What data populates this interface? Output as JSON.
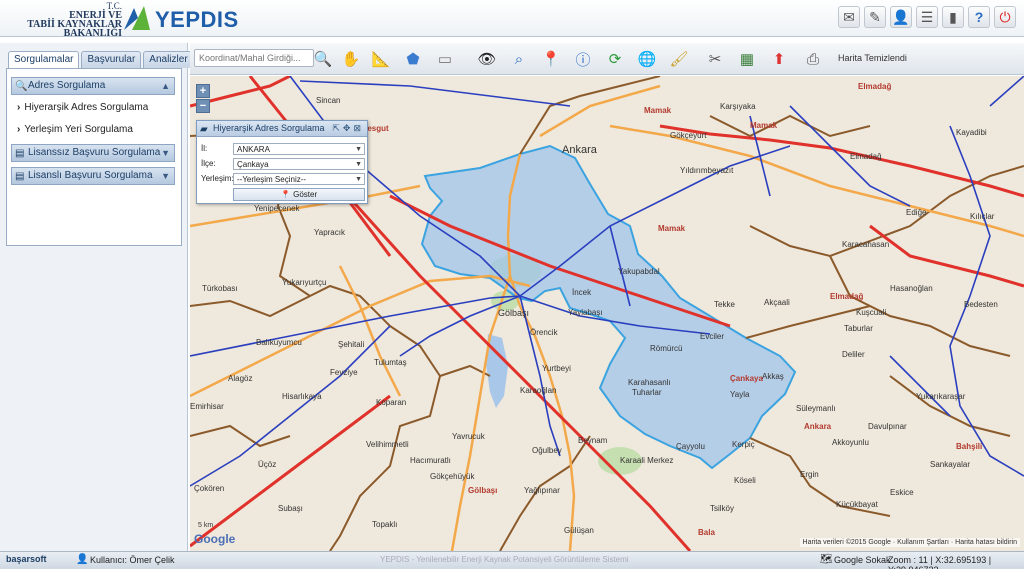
{
  "header": {
    "ministry_line1": "T.C.",
    "ministry_line2": "ENERJİ VE",
    "ministry_line3": "TABİİ KAYNAKLAR",
    "ministry_line4": "BAKANLIĞI",
    "app_name": "YEPDIS",
    "icons": [
      "mail-icon",
      "edit-icon",
      "user-icon",
      "list-icon",
      "document-icon",
      "help-icon",
      "logout-icon"
    ]
  },
  "left_panel": {
    "tabs": [
      "Sorgulamalar",
      "Başvurular",
      "Analizler"
    ],
    "sections": [
      {
        "label": "Adres Sorgulama",
        "items": [
          "Hiyerarşik Adres Sorgulama",
          "Yerleşim Yeri Sorgulama"
        ]
      },
      {
        "label": "Lisanssız Başvuru Sorgulama"
      },
      {
        "label": "Lisanslı Başvuru Sorgulama"
      }
    ]
  },
  "toolbar": {
    "search_placeholder": "Koordinat/Mahal Girdiği...",
    "layer_status": "Harita Temizlendi"
  },
  "dialog": {
    "title": "Hiyerarşik Adres Sorgulama",
    "il_label": "İl:",
    "il_value": "ANKARA",
    "ilce_label": "İlçe:",
    "ilce_value": "Çankaya",
    "yerlesim_label": "Yerleşim:",
    "yerlesim_value": "--Yerleşim Seçiniz--",
    "show_button": "Göster"
  },
  "map": {
    "zoom_in": "+",
    "zoom_out": "−",
    "scale": "5 km",
    "google": "Google",
    "attribution": "Harita verileri ©2015 Google · Kullanım Şartları · Harita hatası bildirin",
    "places": [
      {
        "name": "Sincan",
        "cls": ""
      },
      {
        "name": "Etimesgut",
        "cls": "red"
      },
      {
        "name": "Elmadağ",
        "cls": "red"
      },
      {
        "name": "Karşıyaka",
        "cls": ""
      },
      {
        "name": "Mamak",
        "cls": "red"
      },
      {
        "name": "Mamak",
        "cls": "red"
      },
      {
        "name": "Gökçeyurt",
        "cls": ""
      },
      {
        "name": "Kayadibi",
        "cls": ""
      },
      {
        "name": "Elmadağ",
        "cls": ""
      },
      {
        "name": "Ankara",
        "cls": ""
      },
      {
        "name": "Yıldırımbeyazıt",
        "cls": ""
      },
      {
        "name": "Mamak",
        "cls": "red"
      },
      {
        "name": "Ediğe",
        "cls": ""
      },
      {
        "name": "Kılıçlar",
        "cls": ""
      },
      {
        "name": "Yenipeçenek",
        "cls": ""
      },
      {
        "name": "Yapracık",
        "cls": ""
      },
      {
        "name": "Karacahasan",
        "cls": ""
      },
      {
        "name": "Yukarıyurtçu",
        "cls": ""
      },
      {
        "name": "Yakupabdal",
        "cls": ""
      },
      {
        "name": "Türkobası",
        "cls": ""
      },
      {
        "name": "Tekke",
        "cls": ""
      },
      {
        "name": "Akçaali",
        "cls": ""
      },
      {
        "name": "Hasanoğlan",
        "cls": ""
      },
      {
        "name": "Bedesten",
        "cls": ""
      },
      {
        "name": "Elmadağ",
        "cls": "red"
      },
      {
        "name": "İncek",
        "cls": ""
      },
      {
        "name": "Yaylabaşı",
        "cls": ""
      },
      {
        "name": "Gölbaşı",
        "cls": ""
      },
      {
        "name": "Örencik",
        "cls": ""
      },
      {
        "name": "Evciler",
        "cls": ""
      },
      {
        "name": "Taburlar",
        "cls": ""
      },
      {
        "name": "Kuşcuali",
        "cls": ""
      },
      {
        "name": "Balıkuyumcu",
        "cls": ""
      },
      {
        "name": "Şehitali",
        "cls": ""
      },
      {
        "name": "Tulumtaş",
        "cls": ""
      },
      {
        "name": "Römürcü",
        "cls": ""
      },
      {
        "name": "Deliler",
        "cls": ""
      },
      {
        "name": "Alagöz",
        "cls": ""
      },
      {
        "name": "Fevziye",
        "cls": ""
      },
      {
        "name": "Yurtbeyi",
        "cls": ""
      },
      {
        "name": "Çankaya",
        "cls": "red"
      },
      {
        "name": "Akkaş",
        "cls": ""
      },
      {
        "name": "Hisarlıkaya",
        "cls": ""
      },
      {
        "name": "Karaoğlan",
        "cls": ""
      },
      {
        "name": "Karahasanlı",
        "cls": ""
      },
      {
        "name": "Tuharlar",
        "cls": ""
      },
      {
        "name": "Yayla",
        "cls": ""
      },
      {
        "name": "Yukarıkaraşar",
        "cls": ""
      },
      {
        "name": "Emirhisar",
        "cls": ""
      },
      {
        "name": "Koparan",
        "cls": ""
      },
      {
        "name": "Süleymanlı",
        "cls": ""
      },
      {
        "name": "Davulpınar",
        "cls": ""
      },
      {
        "name": "Ankara",
        "cls": "red"
      },
      {
        "name": "Akkoyunlu",
        "cls": ""
      },
      {
        "name": "Kerpiç",
        "cls": ""
      },
      {
        "name": "Bahşili",
        "cls": "red"
      },
      {
        "name": "Velihimmetli",
        "cls": ""
      },
      {
        "name": "Yavrucuk",
        "cls": ""
      },
      {
        "name": "Çayyolu",
        "cls": ""
      },
      {
        "name": "Beynam",
        "cls": ""
      },
      {
        "name": "Sankayalar",
        "cls": ""
      },
      {
        "name": "Üçöz",
        "cls": ""
      },
      {
        "name": "Hacımuratlı",
        "cls": ""
      },
      {
        "name": "Oğulbey",
        "cls": ""
      },
      {
        "name": "Ergin",
        "cls": ""
      },
      {
        "name": "Eskice",
        "cls": ""
      },
      {
        "name": "Gökçehüyük",
        "cls": ""
      },
      {
        "name": "Karaali Merkez",
        "cls": ""
      },
      {
        "name": "Köseli",
        "cls": ""
      },
      {
        "name": "Küçükbayat",
        "cls": ""
      },
      {
        "name": "Çokören",
        "cls": ""
      },
      {
        "name": "Gölbaşı",
        "cls": "red"
      },
      {
        "name": "Yağlıpınar",
        "cls": ""
      },
      {
        "name": "Tsilköy",
        "cls": ""
      },
      {
        "name": "Subaşı",
        "cls": ""
      },
      {
        "name": "Topaklı",
        "cls": ""
      },
      {
        "name": "Gülüşan",
        "cls": ""
      },
      {
        "name": "Bala",
        "cls": "red"
      }
    ]
  },
  "status": {
    "company": "başarsoft",
    "user": "Kullanıcı: Ömer Çelik",
    "copyright": "YEPDIS - Yenilenebilir Enerji Kaynak Potansiyeli Görüntüleme Sistemi",
    "basemap": "Google Sokak",
    "zoominfo": "Zoom : 11 | X:32.695193 | Y:39.946722"
  }
}
